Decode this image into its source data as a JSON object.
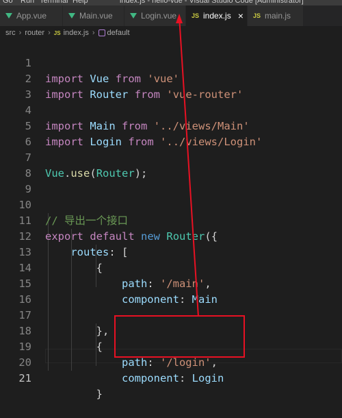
{
  "titlebar": {
    "menu": [
      "Go",
      "Run",
      "Terminal",
      "Help"
    ],
    "window_title": "index.js - hello-vue - Visual Studio Code [Administrator]"
  },
  "tabs": [
    {
      "label": "App.vue",
      "icon": "vue-icon",
      "active": false
    },
    {
      "label": "Main.vue",
      "icon": "vue-icon",
      "active": false
    },
    {
      "label": "Login.vue",
      "icon": "vue-icon",
      "active": false
    },
    {
      "label": "index.js",
      "icon": "js-icon",
      "active": true
    },
    {
      "label": "main.js",
      "icon": "js-icon",
      "active": false
    }
  ],
  "breadcrumb": {
    "items": [
      "src",
      "router",
      "index.js",
      "default"
    ],
    "js_icon_text": "JS"
  },
  "editor": {
    "line_numbers": [
      "1",
      "2",
      "3",
      "4",
      "5",
      "6",
      "7",
      "8",
      "9",
      "10",
      "11",
      "12",
      "13",
      "14",
      "15",
      "16",
      "17",
      "18",
      "19",
      "20",
      "21"
    ],
    "current_line": "21",
    "tokens": {
      "import": "import",
      "from": "from",
      "export": "export",
      "default": "default",
      "new": "new",
      "Vue": "Vue",
      "Router": "Router",
      "Main": "Main",
      "Login": "Login",
      "str_vue": "'vue'",
      "str_vue_router": "'vue-router'",
      "str_main_path": "'../views/Main'",
      "str_login_path": "'../views/Login'",
      "use": "use",
      "comment": "// 导出一个接口",
      "routes": "routes",
      "path": "path",
      "component": "component",
      "str_main_route": "'/main'",
      "str_login_route": "'/login'"
    }
  },
  "colors": {
    "accent_annotation": "#e81123",
    "keyword": "#c586c0",
    "string": "#ce9178",
    "class": "#4ec9b0"
  }
}
